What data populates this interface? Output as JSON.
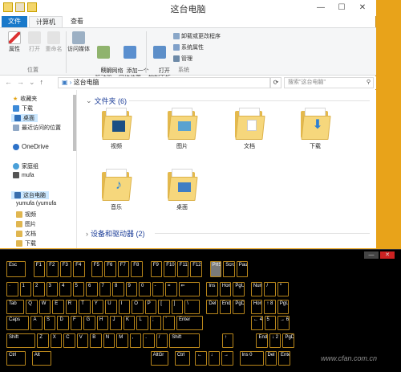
{
  "window": {
    "title": "这台电脑"
  },
  "ribbon_tabs": [
    "文件",
    "计算机",
    "查看"
  ],
  "ribbon": {
    "location_group": {
      "label": "位置",
      "buttons": [
        "属性",
        "打开",
        "重命名"
      ]
    },
    "network_group": {
      "label": "网络",
      "buttons": [
        "访问媒体",
        "映射网络\n驱动器",
        "添加一个\n网络位置"
      ]
    },
    "system_group": {
      "label": "系统",
      "open_control_panel": "打开\n控制面板",
      "items": [
        "卸载或更改程序",
        "系统属性",
        "管理"
      ]
    }
  },
  "address": {
    "path": "这台电脑",
    "search_placeholder": "搜索\"这台电脑\""
  },
  "nav_pane": {
    "favorites": [
      "收藏夹",
      "下载",
      "桌面",
      "最近访问的位置"
    ],
    "onedrive": "OneDrive",
    "homegroup": [
      "家庭组",
      "mufa"
    ],
    "this_pc": [
      "这台电脑",
      "yumufa (yumufa",
      "视频",
      "图片",
      "文档",
      "下载"
    ]
  },
  "content": {
    "folders_header": "文件夹 (6)",
    "folders": [
      "视频",
      "图片",
      "文档",
      "下载",
      "音乐",
      "桌面"
    ],
    "devices_header": "设备和驱动器 (2)"
  },
  "osk": {
    "rows": [
      [
        "Esc",
        "F1",
        "F2",
        "F3",
        "F4",
        "F5",
        "F6",
        "F7",
        "F8",
        "F9",
        "F10",
        "F11",
        "F12",
        "PrtSc",
        "Scroll",
        "Pause"
      ],
      [
        "·",
        "1",
        "2",
        "3",
        "4",
        "5",
        "6",
        "7",
        "8",
        "9",
        "0",
        "-",
        "=",
        "⇐",
        "Ins",
        "Home",
        "PgUp",
        "Num",
        "/",
        "*"
      ],
      [
        "Tab",
        "Q",
        "W",
        "E",
        "R",
        "T",
        "Y",
        "U",
        "I",
        "O",
        "P",
        "[",
        "]",
        "\\",
        "Del",
        "End",
        "PgDn",
        "Home 7",
        "↑ 8",
        "PgUp 9"
      ],
      [
        "Caps",
        "A",
        "S",
        "D",
        "F",
        "G",
        "H",
        "J",
        "K",
        "L",
        ";",
        "'",
        "Enter",
        "← 4",
        "5",
        "→ 6"
      ],
      [
        "Shift",
        "Z",
        "X",
        "C",
        "V",
        "B",
        "N",
        "M",
        ",",
        ".",
        "/",
        "Shift",
        "↑",
        "End 1",
        "↓ 2",
        "PgDn 3"
      ],
      [
        "Ctrl",
        "Alt",
        "AltGr",
        "Ctrl",
        "←",
        "↓",
        "→",
        "Ins 0",
        "Del .",
        "Enter"
      ]
    ]
  },
  "watermark": "www.cfan.com.cn"
}
